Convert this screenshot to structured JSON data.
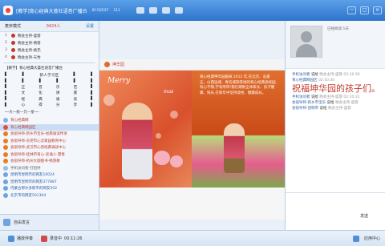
{
  "window": {
    "title": "[教学]育心经典大荟社语音广播台",
    "room_id": "ID:50537",
    "online": "111",
    "controls": [
      "－",
      "□",
      "×"
    ]
  },
  "left_panel": {
    "header_label": "麦序模式",
    "header_count": "0424人",
    "header_action": "设置",
    "mic_queue": [
      {
        "num": "1",
        "name": "晚会主持-盛蓉"
      },
      {
        "num": "2",
        "name": "晚会主持-倩蓉"
      },
      {
        "num": "3",
        "name": "晚会主持-桃无"
      },
      {
        "num": "4",
        "name": "晚会主持-天怡"
      }
    ],
    "room_title": "【教学】育心经典大荟社语音广播台",
    "grid_rows": [
      [
        "▌",
        "▌",
        "新人学习区",
        "▌",
        "▌"
      ],
      [
        "▌",
        "▌",
        "▌",
        "▌",
        "▌",
        "▌"
      ],
      [
        "▌",
        "正",
        "音",
        "示",
        "范",
        "▌"
      ],
      [
        "▌",
        "文",
        "化",
        "讲",
        "座",
        "▌"
      ],
      [
        "▌",
        "经",
        "典",
        "诵",
        "读",
        "▌"
      ],
      [
        "▌",
        "心",
        "得",
        "分",
        "享",
        "▌"
      ]
    ],
    "section": "──大一统一元一星──",
    "users": [
      {
        "name": "育心经典网",
        "tag": "管理",
        "cls": "r",
        "color": "#7fb2e8",
        "sel": false
      },
      {
        "name": "育心经典网园区",
        "tag": "",
        "cls": "r",
        "color": "#e74c3c",
        "sel": true
      },
      {
        "name": "会宿导师-新乡市宝乐-经典诵读传承",
        "tag": "",
        "cls": "r",
        "color": "#e67e22",
        "sel": false
      },
      {
        "name": "会宿导师-东莞市心灵家园教育中心",
        "tag": "",
        "cls": "r",
        "color": "#e67e22",
        "sel": false
      },
      {
        "name": "会宿导师-武汉市心鸽经典诵读中心",
        "tag": "",
        "cls": "r",
        "color": "#e67e22",
        "sel": false
      },
      {
        "name": "会宿导师-桂林市育心-读诵人-慧善",
        "tag": "",
        "cls": "r",
        "color": "#e67e22",
        "sel": false
      },
      {
        "name": "会宿导师-杭州大圆图书-畅游教",
        "tag": "",
        "cls": "r",
        "color": "#e67e22",
        "sel": false
      },
      {
        "name": "  手机访问者-打招呼",
        "tag": "",
        "cls": "g",
        "color": "#9bbbe0",
        "sel": false
      },
      {
        "name": "昆明市昆明市的网友10024",
        "tag": "",
        "cls": "b",
        "color": "#6fa4dc",
        "sel": false
      },
      {
        "name": "昆明市昆明市的网友377887",
        "tag": "",
        "cls": "b",
        "color": "#6fa4dc",
        "sel": false
      },
      {
        "name": "内蒙古鄂尔多斯市的网友502",
        "tag": "",
        "cls": "b",
        "color": "#6fa4dc",
        "sel": false
      },
      {
        "name": "北京市的网友501304",
        "tag": "",
        "cls": "b",
        "color": "#6fa4dc",
        "sel": false
      }
    ],
    "footer_label": "自由发言"
  },
  "center_panel": {
    "card_brand": "坤华园",
    "merry": "Merry",
    "mas": "mas",
    "greeting": "育心经典坤华园临祝 2012 年,在北京、石家庄、山西运城、青岛城阳等地的育心经典读经园,有心不惰,学有所得!我们期盼全体家长、孩子健康、快乐,在新年中坚持读经、健康成长。"
  },
  "right_panel": {
    "profile_line1": "已经阅读:1天",
    "messages": [
      {
        "name": "手机访问者",
        "time": "",
        "text": "说给",
        "extra": "晚会主持-盛蓉 02:10:30"
      },
      {
        "name": "育心经典网园区",
        "time": "02:10:30",
        "text": "",
        "extra": ""
      },
      {
        "name": "",
        "time": "",
        "text": "",
        "extra": ""
      },
      {
        "name": "手机访问者",
        "time": "",
        "text": "说给",
        "extra": "晚会主持-盛蓉 02:10:31"
      },
      {
        "name": "会宿导师-新乡市宝乐",
        "time": "",
        "text": "说给",
        "extra": "晚会主持-盛蓉"
      },
      {
        "name": "会宿导师-昆明市",
        "time": "",
        "text": "说给",
        "extra": "晚会主持-盛蓉"
      }
    ],
    "big_message": "祝福坤华园的孩子们。",
    "send_label": "发送"
  },
  "status_bar": {
    "item1": "播放伴奏",
    "item2": "录音中",
    "time": "00:11:26",
    "app_center": "应用中心"
  }
}
